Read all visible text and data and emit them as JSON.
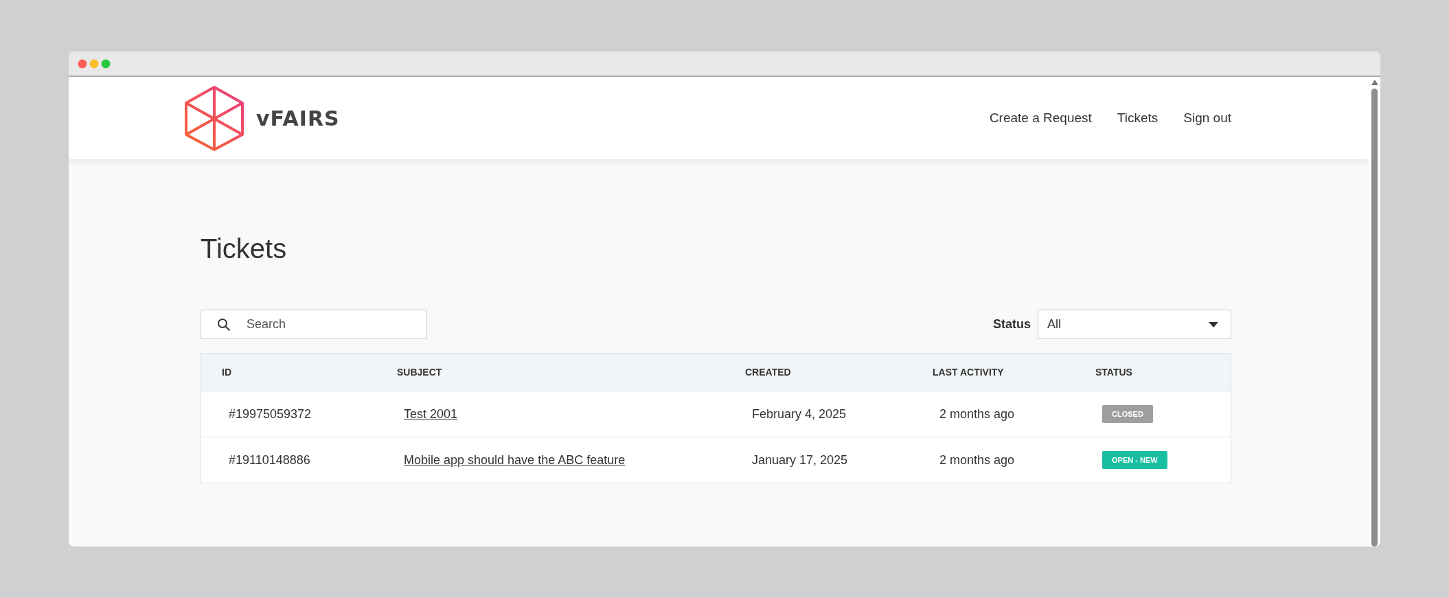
{
  "logo": {
    "text": "vFAIRS"
  },
  "nav": [
    "Create a Request",
    "Tickets",
    "Sign out"
  ],
  "page_title": "Tickets",
  "search": {
    "placeholder": "Search"
  },
  "status_filter": {
    "label": "Status",
    "value": "All"
  },
  "table": {
    "columns": [
      "ID",
      "SUBJECT",
      "CREATED",
      "LAST ACTIVITY",
      "STATUS"
    ],
    "rows": [
      {
        "id": "#19975059372",
        "subject": "Test 2001",
        "created": "February 4, 2025",
        "last_activity": "2 months ago",
        "status": "CLOSED",
        "color": "#9e9e9e"
      },
      {
        "id": "#19110148886",
        "subject": "Mobile app should have the ABC feature",
        "created": "January 17, 2025",
        "last_activity": "2 months ago",
        "status": "OPEN - NEW",
        "color": "#17bfa0"
      }
    ]
  }
}
